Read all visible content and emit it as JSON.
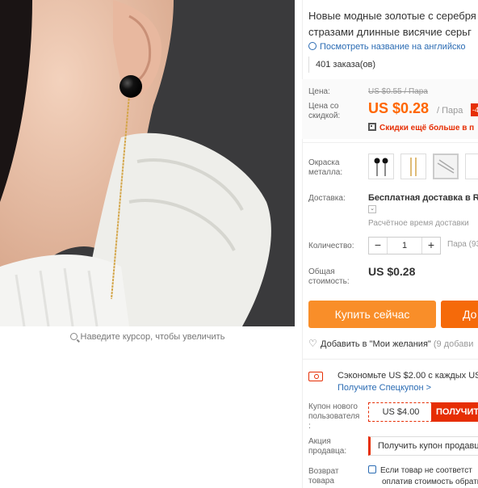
{
  "image": {
    "zoom_hint": "Наведите курсор, чтобы увеличить"
  },
  "product": {
    "title_line1": "Новые модные золотые с серебря",
    "title_line2": "стразами длинные висячие серьг",
    "translate_link": "Посмотреть название на английско",
    "orders": "401 заказа(ов)"
  },
  "price": {
    "label": "Цена:",
    "old": "US $0.55 / Пара",
    "discount_label_line1": "Цена со",
    "discount_label_line2": "скидкой:",
    "current": "US $0.28",
    "per_unit": "/ Пара",
    "badge": "-4",
    "app_promo": "Скидки ещё больше в п"
  },
  "options": {
    "color_label_line1": "Окраска",
    "color_label_line2": "металла:",
    "swatches": [
      "black-pearl",
      "gold-chain",
      "silver-chain"
    ]
  },
  "delivery": {
    "label": "Доставка:",
    "main": "Бесплатная доставка в Ru",
    "chevron": "⌄",
    "estimate": "Расчётное время доставки"
  },
  "quantity": {
    "label": "Количество:",
    "minus": "−",
    "value": "1",
    "plus": "+",
    "unit": "Пара (93"
  },
  "total": {
    "label_line1": "Общая",
    "label_line2": "стоимость:",
    "value": "US $0.28"
  },
  "actions": {
    "buy_now": "Купить сейчас",
    "add_to_cart": "До"
  },
  "wishlist": {
    "label": "Добавить в \"Мои желания\"",
    "count": "(9 добави"
  },
  "coupons": {
    "save_line": "Сэкономьте US $2.00 с каждых US",
    "get_special": "Получите Спецкупон >",
    "new_user_label_line1": "Купон нового",
    "new_user_label_line2": "пользователя",
    "new_user_label_line3": ":",
    "new_user_amount": "US $4.00",
    "new_user_button": "ПОЛУЧИТЕ",
    "seller_label_line1": "Акция",
    "seller_label_line2": "продавца:",
    "seller_button": "Получить купон продавц"
  },
  "returns": {
    "label_line1": "Возврат",
    "label_line2": "товара",
    "text_line1": "Если товар не соответст",
    "text_line2": "оплатив стоимость обратн"
  },
  "colors": {
    "accent": "#f60",
    "buy_button": "#f98e29",
    "cart_button": "#f56a0a",
    "coupon_red": "#e62e04",
    "link_blue": "#2a6bb3"
  }
}
